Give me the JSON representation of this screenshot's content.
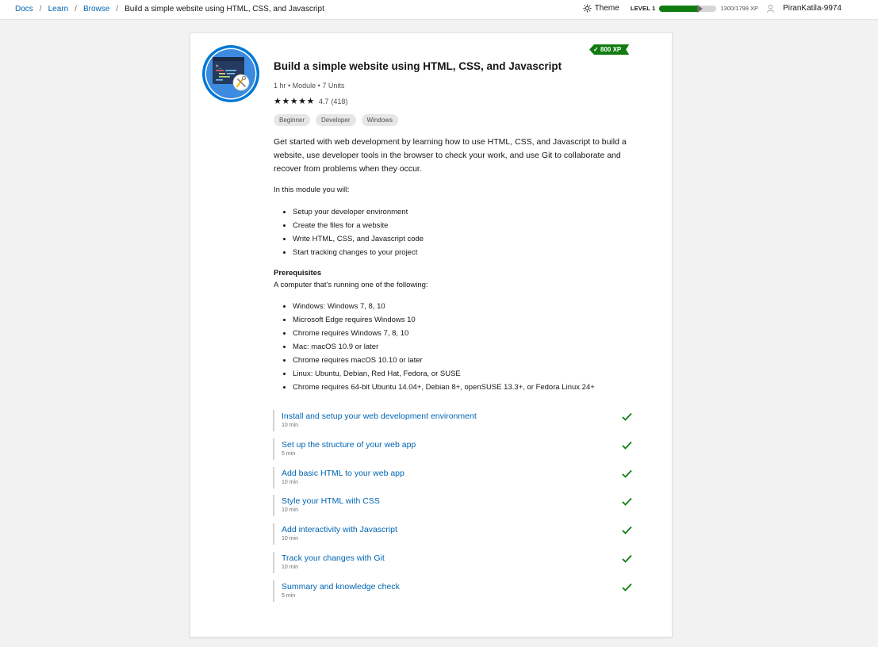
{
  "breadcrumb": [
    "Docs",
    "Learn",
    "Browse"
  ],
  "breadcrumb_current": "Build a simple website using HTML, CSS, and Javascript",
  "header": {
    "theme_label": "Theme",
    "level_label": "LEVEL 1",
    "xp_progress": 0.723,
    "xp_text": "1300/1799 XP",
    "username": "PiranKatila-9974"
  },
  "module": {
    "xp_badge": "800 XP",
    "title": "Build a simple website using HTML, CSS, and Javascript",
    "meta": "1 hr • Module • 7 Units",
    "rating_value": "4.7",
    "rating_count": "(418)",
    "stars": 5,
    "tags": [
      "Beginner",
      "Developer",
      "Windows"
    ],
    "description": "Get started with web development by learning how to use HTML, CSS, and Javascript to build a website, use developer tools in the browser to check your work, and use Git to collaborate and recover from problems when they occur.",
    "intro": "In this module you will:",
    "objectives": [
      "Setup your developer environment",
      "Create the files for a website",
      "Write HTML, CSS, and Javascript code",
      "Start tracking changes to your project"
    ],
    "prereq_heading": "Prerequisites",
    "prereq_subtitle": "A computer that's running one of the following:",
    "prerequisites": [
      "Windows: Windows 7, 8, 10",
      "Microsoft Edge requires Windows 10",
      "Chrome requires Windows 7, 8, 10",
      "Mac: macOS 10.9 or later",
      "Chrome requires macOS 10.10 or later",
      "Linux: Ubuntu, Debian, Red Hat, Fedora, or SUSE",
      "Chrome requires 64-bit Ubuntu 14.04+, Debian 8+, openSUSE 13.3+, or Fedora Linux 24+"
    ],
    "units": [
      {
        "title": "Install and setup your web development environment",
        "duration": "10 min",
        "completed": true
      },
      {
        "title": "Set up the structure of your web app",
        "duration": "5 min",
        "completed": true
      },
      {
        "title": "Add basic HTML to your web app",
        "duration": "10 min",
        "completed": true
      },
      {
        "title": "Style your HTML with CSS",
        "duration": "10 min",
        "completed": true
      },
      {
        "title": "Add interactivity with Javascript",
        "duration": "10 min",
        "completed": true
      },
      {
        "title": "Track your changes with Git",
        "duration": "10 min",
        "completed": true
      },
      {
        "title": "Summary and knowledge check",
        "duration": "5 min",
        "completed": true
      }
    ]
  },
  "colors": {
    "link": "#0065b3",
    "success": "#107c10",
    "badge_ring": "#0078d4"
  },
  "icons": [
    "sun-icon",
    "person-icon",
    "checkmark-icon",
    "module-badge-icon"
  ]
}
